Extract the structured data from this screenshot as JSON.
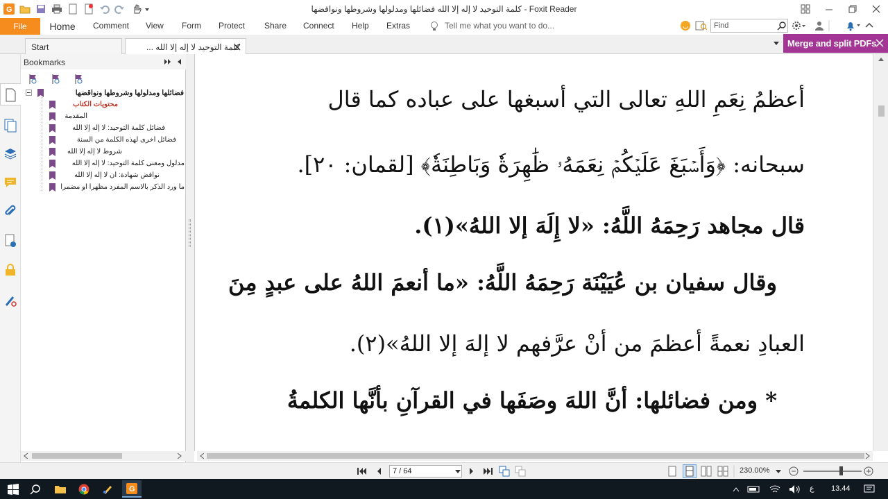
{
  "window": {
    "title": "كلمة التوحيد لا إله إلا الله فضائلها ومدلولها وشروطها ونواقضها - Foxit Reader"
  },
  "ribbon": {
    "tabs": [
      "File",
      "Home",
      "Comment",
      "View",
      "Form",
      "Protect",
      "Share",
      "Connect",
      "Help",
      "Extras"
    ],
    "tell_me_placeholder": "Tell me what you want to do...",
    "find_placeholder": "Find"
  },
  "doc_tabs": {
    "start": "Start",
    "current": "كلمة التوحيد لا إله إلا الله ..."
  },
  "promo": {
    "label": "Merge and split PDFs"
  },
  "bookmarks": {
    "header": "Bookmarks",
    "root": "فضائلها ومدلولها وشروطها ونواقضها",
    "items": [
      "محتويات الكتاب",
      "المقدمة",
      "فضائل كلمة التوحيد: لا إله إلا الله",
      "فضائل أخرى لهذه الكلمة من السنة",
      "شروط لا إله إلا الله",
      "مدلول ومعنى كلمة التوحيد: لا إله إلا الله",
      "نواقض شهادة: أن لا إله إلا الله",
      "ما ورد الذكر بالاسم المفرد مظهرا أو مضمرا"
    ]
  },
  "document": {
    "lines": [
      "أعظمُ نِعَمِ اللهِ تعالى التي أسبغها على عباده كما قال",
      "سبحانه: ﴿وَأَسۡبَغَ عَلَيۡكُمۡ نِعَمَهُۥ ظَٰهِرَةٗ وَبَاطِنَةٗ﴾ [لقمان: ٢٠].",
      "قال مجاهد رَحِمَهُ اللَّهُ: «لا إِلَهَ إلا اللهُ»(١).",
      "وقال سفيان بن عُيَيْنَة رَحِمَهُ اللَّهُ: «ما أنعمَ اللهُ على عبدٍ مِنَ",
      "العبادِ نعمةً أعظمَ من أنْ عرَّفهم لا إلهَ إلا اللهُ»(٢).",
      "* ومن فضائلها: أنَّ اللهَ وصَفَها في القرآنِ بأنَّها الكلمةُ"
    ]
  },
  "status": {
    "page_value": "7 / 64",
    "zoom": "230.00%"
  },
  "taskbar": {
    "language": "ع",
    "time": "13.44"
  }
}
